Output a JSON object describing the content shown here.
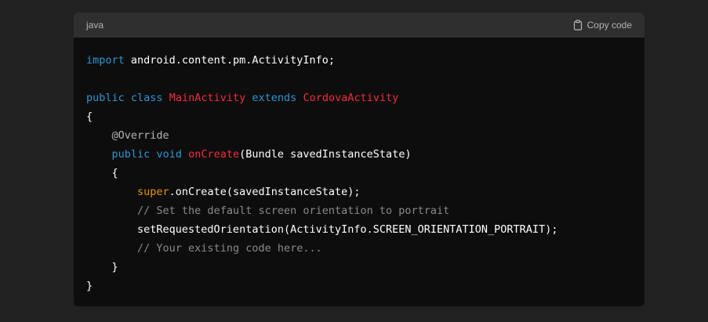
{
  "header": {
    "language": "java",
    "copy_label": "Copy code",
    "copy_icon": "clipboard-icon"
  },
  "code": {
    "colors": {
      "keyword": "#2e95d3",
      "class_name": "#f22c3d",
      "function": "#f22c3d",
      "super": "#e9950c",
      "comment": "#8a8a8a",
      "plain": "#ffffff"
    },
    "lines": [
      {
        "tokens": [
          {
            "t": "import",
            "c": "kw"
          },
          {
            "t": " android.content.pm.ActivityInfo;",
            "c": "plain"
          }
        ]
      },
      {
        "tokens": []
      },
      {
        "tokens": [
          {
            "t": "public",
            "c": "kw"
          },
          {
            "t": " ",
            "c": "plain"
          },
          {
            "t": "class",
            "c": "kw"
          },
          {
            "t": " ",
            "c": "plain"
          },
          {
            "t": "MainActivity",
            "c": "cls"
          },
          {
            "t": " ",
            "c": "plain"
          },
          {
            "t": "extends",
            "c": "kw"
          },
          {
            "t": " ",
            "c": "plain"
          },
          {
            "t": "CordovaActivity",
            "c": "cls"
          }
        ]
      },
      {
        "tokens": [
          {
            "t": "{",
            "c": "plain"
          }
        ]
      },
      {
        "tokens": [
          {
            "t": "    ",
            "c": "plain"
          },
          {
            "t": "@Override",
            "c": "ann"
          }
        ]
      },
      {
        "tokens": [
          {
            "t": "    ",
            "c": "plain"
          },
          {
            "t": "public",
            "c": "kw"
          },
          {
            "t": " ",
            "c": "plain"
          },
          {
            "t": "void",
            "c": "kw"
          },
          {
            "t": " ",
            "c": "plain"
          },
          {
            "t": "onCreate",
            "c": "fn"
          },
          {
            "t": "(Bundle savedInstanceState)",
            "c": "plain"
          }
        ]
      },
      {
        "tokens": [
          {
            "t": "    {",
            "c": "plain"
          }
        ]
      },
      {
        "tokens": [
          {
            "t": "        ",
            "c": "plain"
          },
          {
            "t": "super",
            "c": "sup"
          },
          {
            "t": ".onCreate(savedInstanceState);",
            "c": "plain"
          }
        ]
      },
      {
        "tokens": [
          {
            "t": "        ",
            "c": "plain"
          },
          {
            "t": "// Set the default screen orientation to portrait",
            "c": "cm"
          }
        ]
      },
      {
        "tokens": [
          {
            "t": "        setRequestedOrientation(ActivityInfo.SCREEN_ORIENTATION_PORTRAIT);",
            "c": "plain"
          }
        ]
      },
      {
        "tokens": [
          {
            "t": "        ",
            "c": "plain"
          },
          {
            "t": "// Your existing code here...",
            "c": "cm"
          }
        ]
      },
      {
        "tokens": [
          {
            "t": "    }",
            "c": "plain"
          }
        ]
      },
      {
        "tokens": [
          {
            "t": "}",
            "c": "plain"
          }
        ]
      }
    ]
  }
}
